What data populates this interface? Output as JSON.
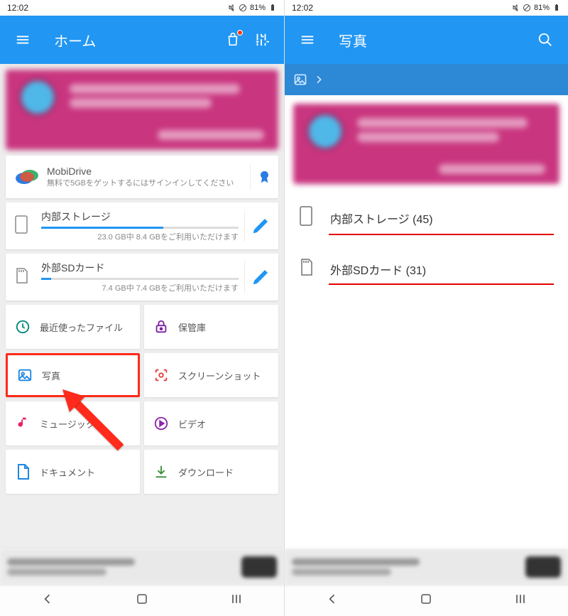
{
  "status": {
    "time": "12:02",
    "battery": "81%"
  },
  "left": {
    "title": "ホーム",
    "mobidrive": {
      "title": "MobiDrive",
      "subtitle": "無料で5GBをゲットするにはサインインしてください"
    },
    "internal": {
      "title": "内部ストレージ",
      "subtitle": "23.0 GB中 8.4 GBをご利用いただけます",
      "fill_pct": 62
    },
    "sdcard": {
      "title": "外部SDカード",
      "subtitle": "7.4 GB中 7.4 GBをご利用いただけます",
      "fill_pct": 5
    },
    "tiles": {
      "recent": "最近使ったファイル",
      "vault": "保管庫",
      "photos": "写真",
      "screenshots": "スクリーンショット",
      "music": "ミュージック",
      "video": "ビデオ",
      "documents": "ドキュメント",
      "downloads": "ダウンロード"
    }
  },
  "right": {
    "title": "写真",
    "items": [
      {
        "label": "内部ストレージ (45)"
      },
      {
        "label": "外部SDカード (31)"
      }
    ]
  }
}
